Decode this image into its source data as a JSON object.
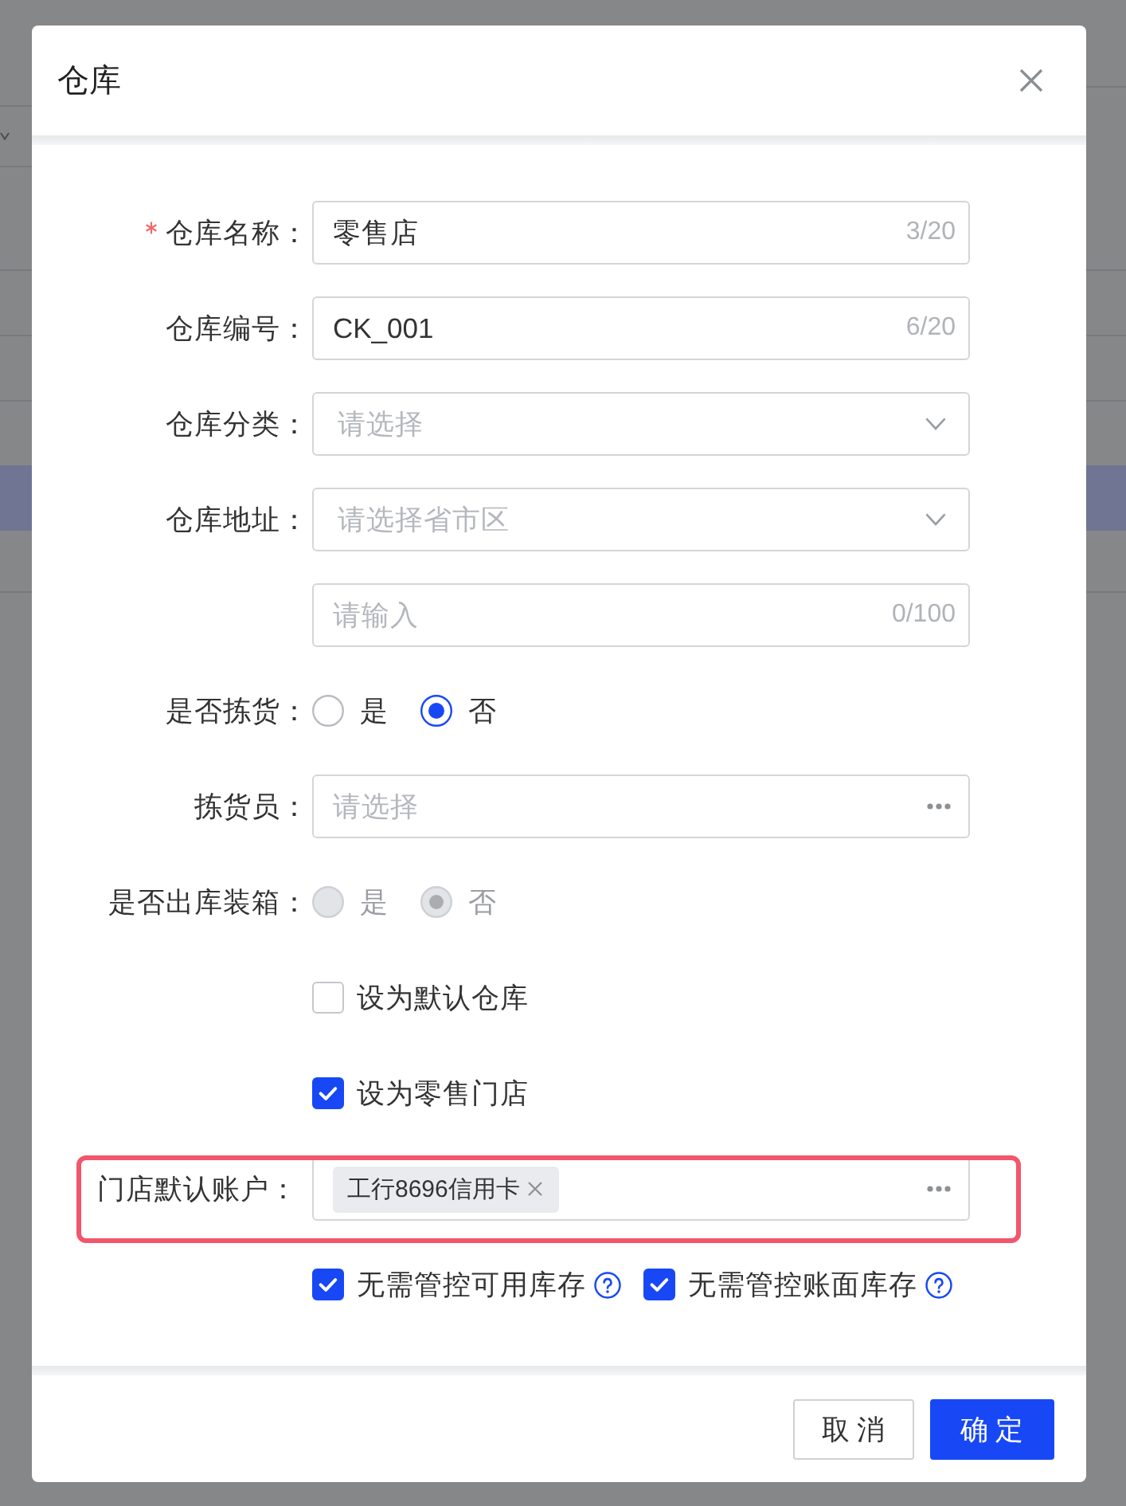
{
  "dialog": {
    "title": "仓库"
  },
  "form": {
    "fields": [
      {
        "kind": "text",
        "label": "仓库名称：",
        "required": true,
        "value": "零售店",
        "counter": "3/20"
      },
      {
        "kind": "text",
        "label": "仓库编号：",
        "value": "CK_001",
        "counter": "6/20"
      },
      {
        "kind": "select",
        "label": "仓库分类：",
        "placeholder": "请选择"
      },
      {
        "kind": "select",
        "label": "仓库地址：",
        "placeholder": "请选择省市区"
      },
      {
        "kind": "text",
        "placeholder": "请输入",
        "counter": "0/100"
      },
      {
        "kind": "radio",
        "label": "是否拣货：",
        "disabled": false,
        "options": [
          {
            "label": "是",
            "selected": false
          },
          {
            "label": "否",
            "selected": true
          }
        ]
      },
      {
        "kind": "picker",
        "label": "拣货员：",
        "placeholder": "请选择"
      },
      {
        "kind": "radio",
        "label": "是否出库装箱：",
        "disabled": true,
        "options": [
          {
            "label": "是",
            "selected": false
          },
          {
            "label": "否",
            "selected": true
          }
        ]
      },
      {
        "kind": "checkboxes",
        "items": [
          {
            "label": "设为默认仓库",
            "checked": false
          }
        ]
      },
      {
        "kind": "checkboxes",
        "items": [
          {
            "label": "设为零售门店",
            "checked": true
          }
        ]
      },
      {
        "kind": "picker",
        "label": "门店默认账户：",
        "highlighted": true,
        "tags": [
          {
            "label": "工行8696信用卡"
          }
        ]
      },
      {
        "kind": "checkboxes",
        "items": [
          {
            "label": "无需管控可用库存",
            "checked": true,
            "help": true
          },
          {
            "label": "无需管控账面库存",
            "checked": true,
            "help": true
          }
        ]
      }
    ]
  },
  "footer": {
    "buttons": [
      {
        "label": "取消",
        "kind": "default"
      },
      {
        "label": "确定",
        "kind": "primary"
      }
    ]
  }
}
